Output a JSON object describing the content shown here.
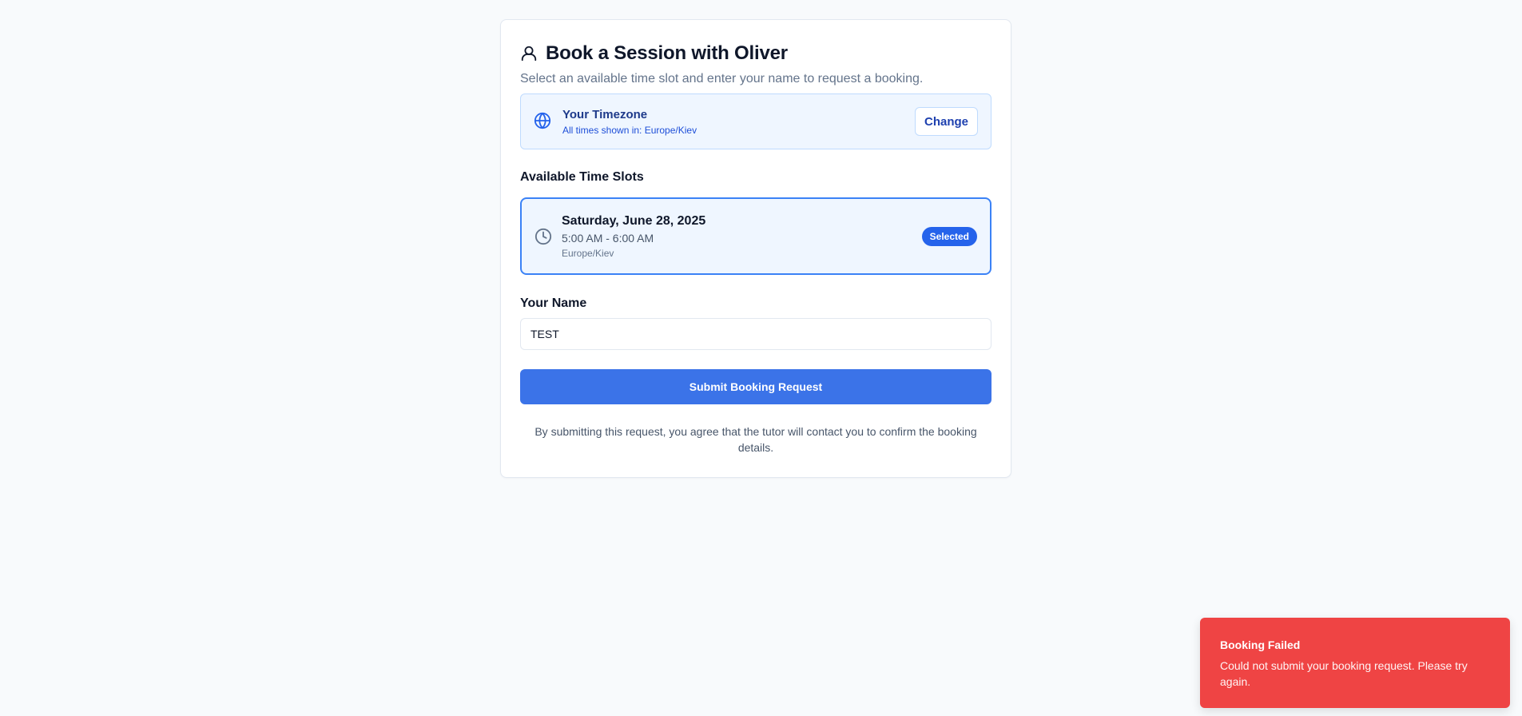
{
  "booking": {
    "title": "Book a Session with Oliver",
    "subtitle": "Select an available time slot and enter your name to request a booking.",
    "title_icon": "user-icon"
  },
  "timezone": {
    "icon": "globe-icon",
    "title": "Your Timezone",
    "subtitle": "All times shown in: Europe/Kiev",
    "change_label": "Change"
  },
  "slots": {
    "section_label": "Available Time Slots",
    "items": [
      {
        "icon": "clock-icon",
        "date": "Saturday, June 28, 2025",
        "time": "5:00 AM - 6:00 AM",
        "timezone": "Europe/Kiev",
        "badge": "Selected"
      }
    ]
  },
  "name": {
    "label": "Your Name",
    "value": "TEST"
  },
  "submit_label": "Submit Booking Request",
  "disclaimer": "By submitting this request, you agree that the tutor will contact you to confirm the booking details.",
  "toast": {
    "title": "Booking Failed",
    "message": "Could not submit your booking request. Please try again."
  },
  "colors": {
    "accent": "#3b73e8",
    "selected_border": "#3b82f6",
    "info_bg": "#eff6ff",
    "error": "#ef4444"
  }
}
